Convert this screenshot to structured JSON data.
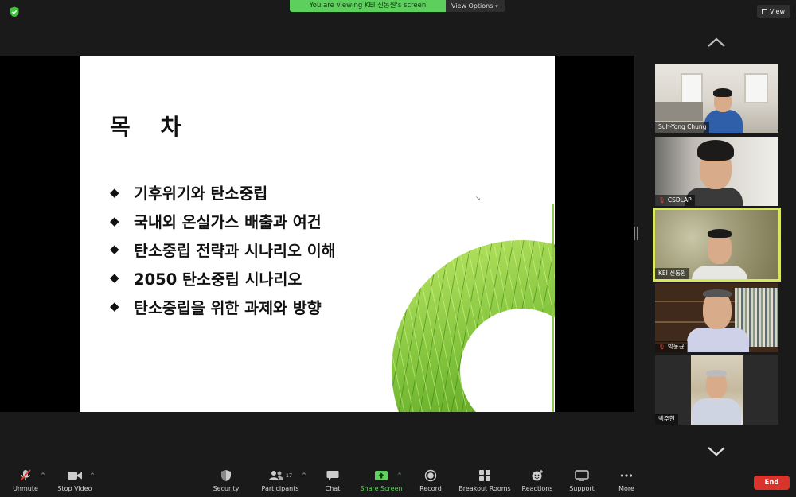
{
  "top_bar": {
    "viewing_banner": "You are viewing KEI 신동원's screen",
    "view_options_label": "View Options",
    "view_label": "View"
  },
  "slide": {
    "title": "목 차",
    "agenda": [
      "기후위기와 탄소중립",
      "국내외 온실가스 배출과 여건",
      "탄소중립 전략과 시나리오 이해",
      "2050 탄소중립 시나리오",
      "탄소중립을 위한 과제와 방향"
    ],
    "bullet": "◆"
  },
  "gallery": {
    "participants": [
      {
        "name": "Suh-Yong Chung",
        "muted": false,
        "active": false
      },
      {
        "name": "CSDLAP",
        "muted": true,
        "active": false
      },
      {
        "name": "KEI 신동원",
        "muted": false,
        "active": true
      },
      {
        "name": "박동균",
        "muted": true,
        "active": false
      },
      {
        "name": "백주현",
        "muted": false,
        "active": false
      }
    ]
  },
  "toolbar": {
    "unmute": "Unmute",
    "stop_video": "Stop Video",
    "security": "Security",
    "participants": "Participants",
    "participants_count": "17",
    "chat": "Chat",
    "share_screen": "Share Screen",
    "record": "Record",
    "breakout_rooms": "Breakout Rooms",
    "reactions": "Reactions",
    "support": "Support",
    "more": "More",
    "end": "End"
  },
  "colors": {
    "share_green": "#5fd15f",
    "end_red": "#d9342b",
    "active_speaker": "#d8e85a",
    "muted_red": "#e83a2f"
  }
}
